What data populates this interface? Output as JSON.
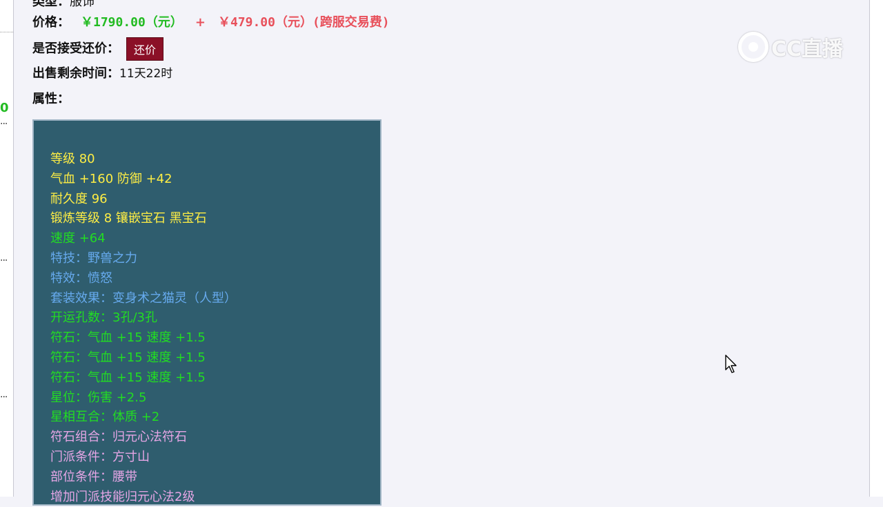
{
  "top_cut": {
    "label": "类型：",
    "value": "服饰"
  },
  "price": {
    "label": "价格：",
    "main": "￥1790.00（元）",
    "plus": "+",
    "fee": "￥479.00（元）(跨服交易费)"
  },
  "counter_offer": {
    "label": "是否接受还价：",
    "button": "还价"
  },
  "time_left": {
    "label": "出售剩余时间：",
    "value": "11天22时"
  },
  "attributes": {
    "label": "属性：",
    "lines": [
      {
        "text": "等级 80",
        "color": "yellow"
      },
      {
        "text": "气血 +160 防御 +42",
        "color": "yellow"
      },
      {
        "text": "耐久度 96",
        "color": "yellow"
      },
      {
        "text": "锻炼等级 8 镶嵌宝石 黑宝石",
        "color": "yellow"
      },
      {
        "text": "速度 +64",
        "color": "green"
      },
      {
        "text": "特技：野兽之力",
        "color": "blue"
      },
      {
        "text": "特效：愤怒",
        "color": "blue"
      },
      {
        "text": "套装效果：变身术之猫灵（人型）",
        "color": "blue"
      },
      {
        "text": "开运孔数：3孔/3孔",
        "color": "green"
      },
      {
        "text": "符石：气血 +15 速度 +1.5",
        "color": "green"
      },
      {
        "text": "符石：气血 +15 速度 +1.5",
        "color": "green"
      },
      {
        "text": "符石：气血 +15 速度 +1.5",
        "color": "green"
      },
      {
        "text": "星位：伤害 +2.5",
        "color": "green"
      },
      {
        "text": "星相互合：体质 +2",
        "color": "green"
      },
      {
        "text": "符石组合：归元心法符石",
        "color": "pink"
      },
      {
        "text": "门派条件：方寸山",
        "color": "pink"
      },
      {
        "text": "部位条件：腰带",
        "color": "pink"
      },
      {
        "text": "增加门派技能归元心法2级",
        "color": "pink"
      }
    ]
  },
  "left_strip": {
    "number": "0",
    "dots": "..."
  },
  "watermark": {
    "text": "CC直播"
  },
  "colors": {
    "price_green": "#22bb22",
    "price_red": "#e8505b",
    "button_bg": "#8b1027",
    "attr_bg": "#2f5d6e",
    "yellow": "#ffee44",
    "green": "#22dd22",
    "blue": "#66aaee",
    "pink": "#e6a6e6"
  }
}
